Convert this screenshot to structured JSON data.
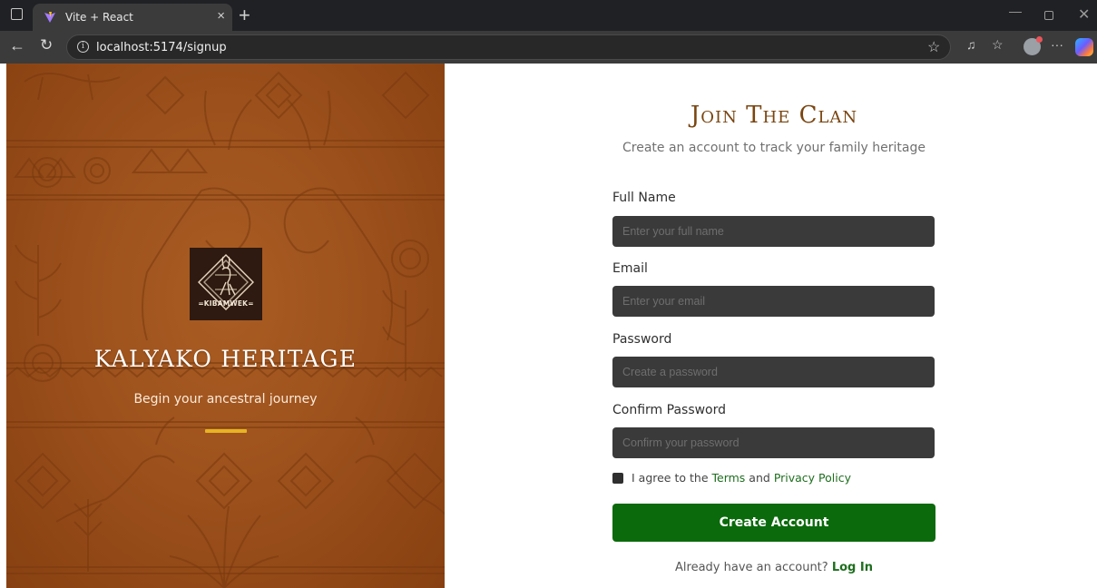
{
  "browser": {
    "tab_title": "Vite + React",
    "tab_close": "×",
    "new_tab": "+",
    "url": "localhost:5174/signup",
    "win_min": "—",
    "win_close": "✕",
    "more_label": "···"
  },
  "hero": {
    "logo_text": "=KIBAMWEK=",
    "title": "KALYAKO HERITAGE",
    "subtitle": "Begin your ancestral journey",
    "colors": {
      "background": "#a85a22",
      "accent": "#e6b422"
    }
  },
  "form": {
    "title": "Join The Clan",
    "subtitle": "Create an account to track your family heritage",
    "fields": [
      {
        "label": "Full Name",
        "placeholder": "Enter your full name",
        "value": ""
      },
      {
        "label": "Email",
        "placeholder": "Enter your email",
        "value": ""
      },
      {
        "label": "Password",
        "placeholder": "Create a password",
        "value": ""
      },
      {
        "label": "Confirm Password",
        "placeholder": "Confirm your password",
        "value": ""
      }
    ],
    "agree": {
      "prefix": "I agree to the",
      "terms": "Terms",
      "and": "and",
      "privacy": "Privacy Policy",
      "checked": false
    },
    "submit_label": "Create Account",
    "login_prompt": "Already have an account?",
    "login_link": "Log In",
    "colors": {
      "primary": "#0b6a0b",
      "title": "#7a4510",
      "input_bg": "#3a3a3a"
    }
  }
}
